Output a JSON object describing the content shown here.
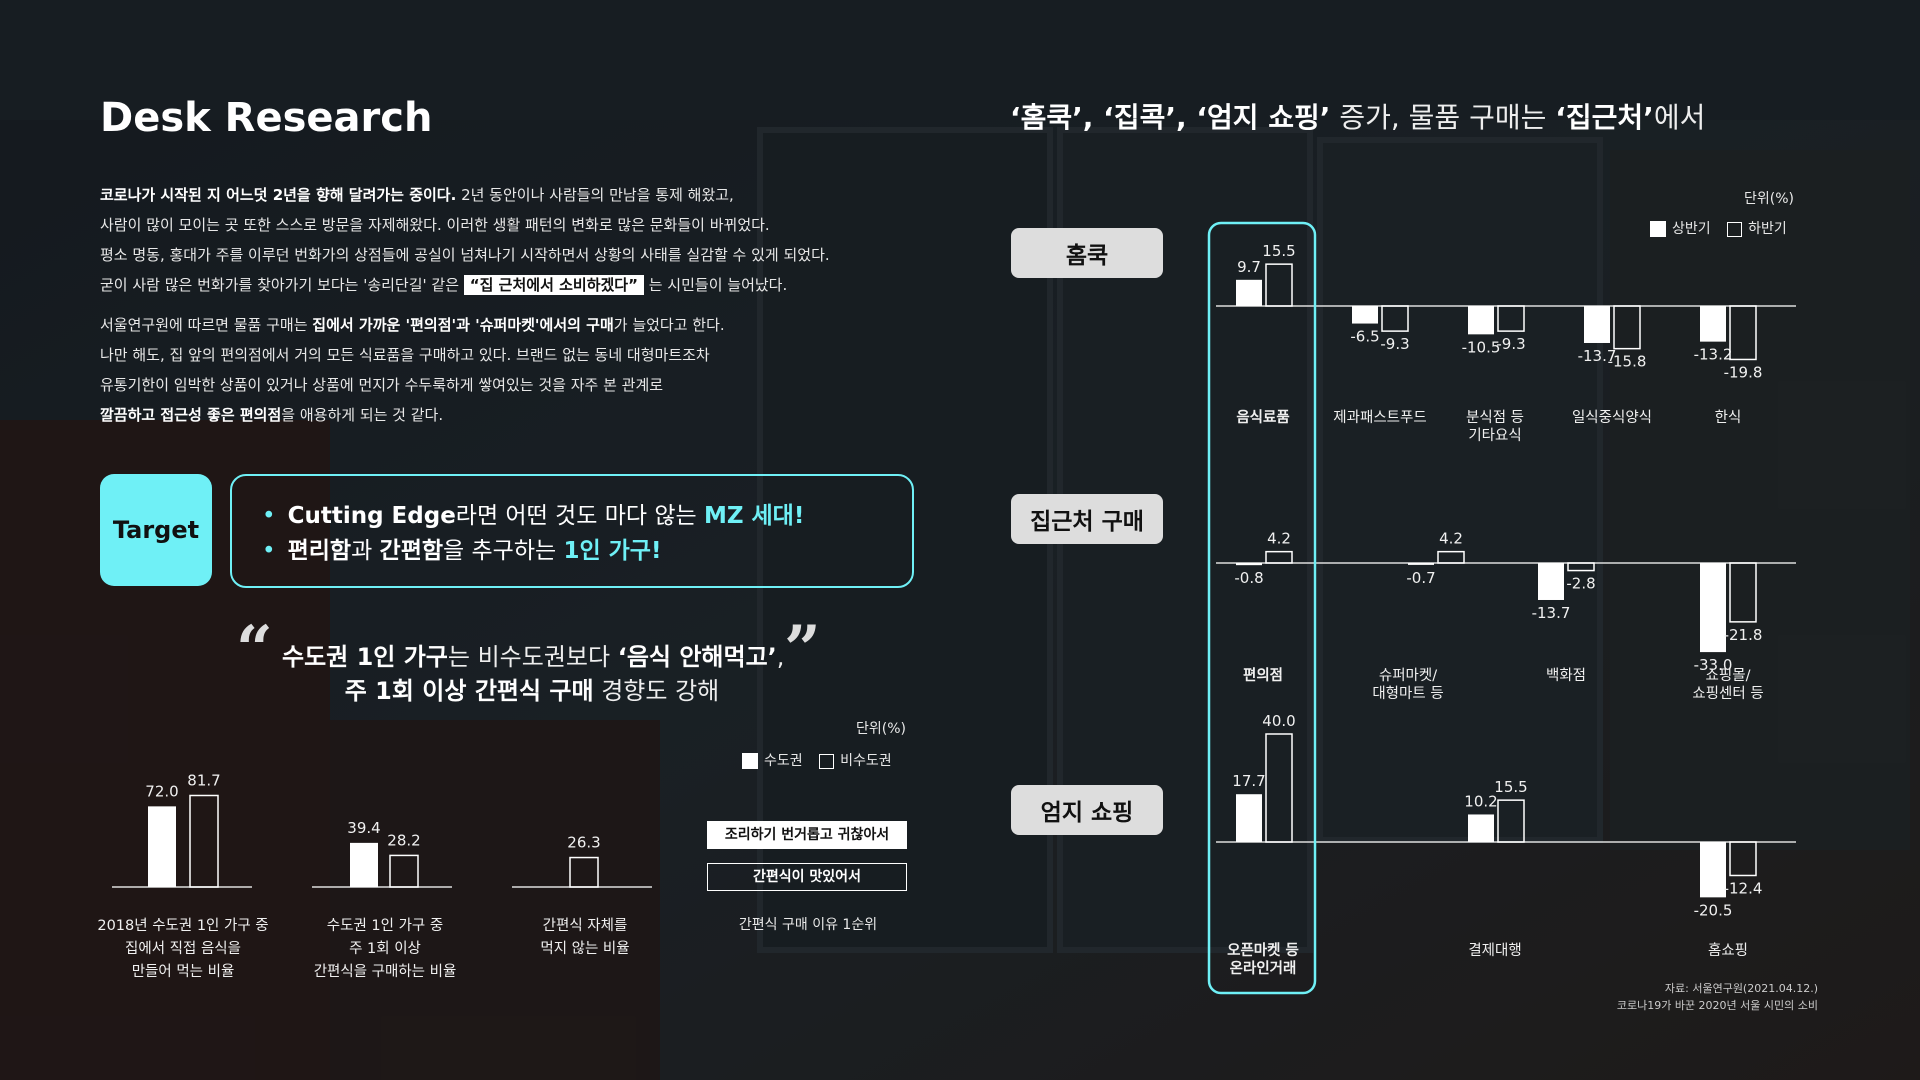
{
  "title": "Desk Research",
  "intro": {
    "p1_l1_bold": "코로나가 시작된 지 어느덧 2년을 향해 달려가는 중이다.",
    "p1_l1_rest": " 2년 동안이나 사람들의 만남을 통제 해왔고,",
    "p1_l2": "사람이 많이 모이는 곳 또한 스스로 방문을 자제해왔다. 이러한 생활 패턴의 변화로 많은 문화들이 바뀌었다.",
    "p1_l3": "평소 명동, 홍대가 주를 이루던 번화가의 상점들에 공실이 넘쳐나기 시작하면서 상황의 사태를 실감할 수 있게 되었다.",
    "p1_l4_a": "굳이 사람 많은 번화가를 찾아가기 보다는 '송리단길' 같은 ",
    "p1_l4_hl": "“집 근처에서 소비하겠다”",
    "p1_l4_b": " 는 시민들이 늘어났다.",
    "p2_l1_a": "서울연구원에 따르면 물품 구매는 ",
    "p2_l1_bold": "집에서 가까운 '편의점'과 '슈퍼마켓'에서의 구매",
    "p2_l1_b": "가 늘었다고 한다.",
    "p2_l2": "나만 해도, 집 앞의 편의점에서 거의 모든 식료품을 구매하고 있다. 브랜드 없는 동네 대형마트조차",
    "p2_l3": "유통기한이 임박한 상품이 있거나 상품에 먼지가 수두룩하게 쌓여있는 것을 자주 본 관계로",
    "p2_l4_bold": "깔끔하고 접근성 좋은 편의점",
    "p2_l4_rest": "을 애용하게 되는 것 같다."
  },
  "target": {
    "label": "Target",
    "line1_bold": "Cutting Edge",
    "line1_mid": "라면 어떤 것도 마다 않는 ",
    "line1_cyan": "MZ 세대!",
    "line2_bold1": "편리함",
    "line2_mid1": "과 ",
    "line2_bold2": "간편함",
    "line2_mid2": "을 추구하는 ",
    "line2_cyan": "1인 가구!"
  },
  "quote": {
    "open_mark": "“",
    "close_mark": "”",
    "l1_bold1": "수도권 1인 가구",
    "l1_mid": "는 비수도권보다 ",
    "l1_bold2": "‘음식 안해먹고’",
    "l1_end": ",",
    "l2_bold": "주 1회 이상 간편식 구매",
    "l2_rest": " 경향도 강해"
  },
  "left_chart_meta": {
    "unit": "단위(%)",
    "legend_metro": "수도권",
    "legend_nonmetro": "비수도권",
    "reason1": "조리하기 번거롭고 귀찮아서",
    "reason2": "간편식이 맛있어서",
    "reason_caption": "간편식 구매 이유 1순위"
  },
  "right_title": {
    "a": "‘홈쿡’, ‘집콕’, ‘엄지 쇼핑’",
    "b": " 증가, 물품 구매는 ",
    "c": "‘집근처’",
    "d": "에서"
  },
  "right_meta": {
    "unit": "단위(%)",
    "legend_h1": "상반기",
    "legend_h2": "하반기",
    "source_l1": "자료: 서울연구원(2021.04.12.)",
    "source_l2": "코로나19가 바꾼 2020년 서울 시민의 소비"
  },
  "sections": [
    "홈쿡",
    "집근처 구매",
    "엄지 쇼핑"
  ],
  "colors": {
    "accent": "#6ff0f6",
    "bar_fill": "#ffffff",
    "background": "#141a1f"
  },
  "chart_data": [
    {
      "type": "bar",
      "title": "",
      "series": [
        {
          "name": "수도권",
          "values": [
            72.0,
            39.4,
            null
          ]
        },
        {
          "name": "비수도권",
          "values": [
            81.7,
            28.2,
            26.3
          ]
        }
      ],
      "categories": [
        "2018년 수도권 1인 가구 중\n집에서 직접 음식을\n만들어 먹는 비율",
        "수도권 1인 가구 중\n주 1회 이상\n간편식을 구매하는 비율",
        "간편식 자체를\n먹지 않는 비율"
      ],
      "unit": "단위(%)",
      "ylim": [
        0,
        100
      ]
    },
    {
      "type": "bar",
      "group": "홈쿡",
      "categories": [
        "음식료품",
        "제과패스트푸드",
        "분식점 등\n기타요식",
        "일식중식양식",
        "한식"
      ],
      "series": [
        {
          "name": "상반기",
          "values": [
            9.7,
            -6.5,
            -10.5,
            -13.7,
            -13.2
          ]
        },
        {
          "name": "하반기",
          "values": [
            15.5,
            -9.3,
            -9.3,
            -15.8,
            -19.8
          ]
        }
      ],
      "unit": "단위(%)"
    },
    {
      "type": "bar",
      "group": "집근처 구매",
      "categories": [
        "편의점",
        "슈퍼마켓/\n대형마트 등",
        "백화점",
        "쇼핑몰/\n쇼핑센터 등"
      ],
      "series": [
        {
          "name": "상반기",
          "values": [
            -0.8,
            -0.7,
            -13.7,
            -33.0
          ]
        },
        {
          "name": "하반기",
          "values": [
            4.2,
            4.2,
            -2.8,
            -21.8
          ]
        }
      ],
      "unit": "단위(%)"
    },
    {
      "type": "bar",
      "group": "엄지 쇼핑",
      "categories": [
        "오픈마켓 등\n온라인거래",
        "결제대행",
        "홈쇼핑"
      ],
      "series": [
        {
          "name": "상반기",
          "values": [
            17.7,
            10.2,
            -20.5
          ]
        },
        {
          "name": "하반기",
          "values": [
            40.0,
            15.5,
            -12.4
          ]
        }
      ],
      "unit": "단위(%)"
    }
  ]
}
